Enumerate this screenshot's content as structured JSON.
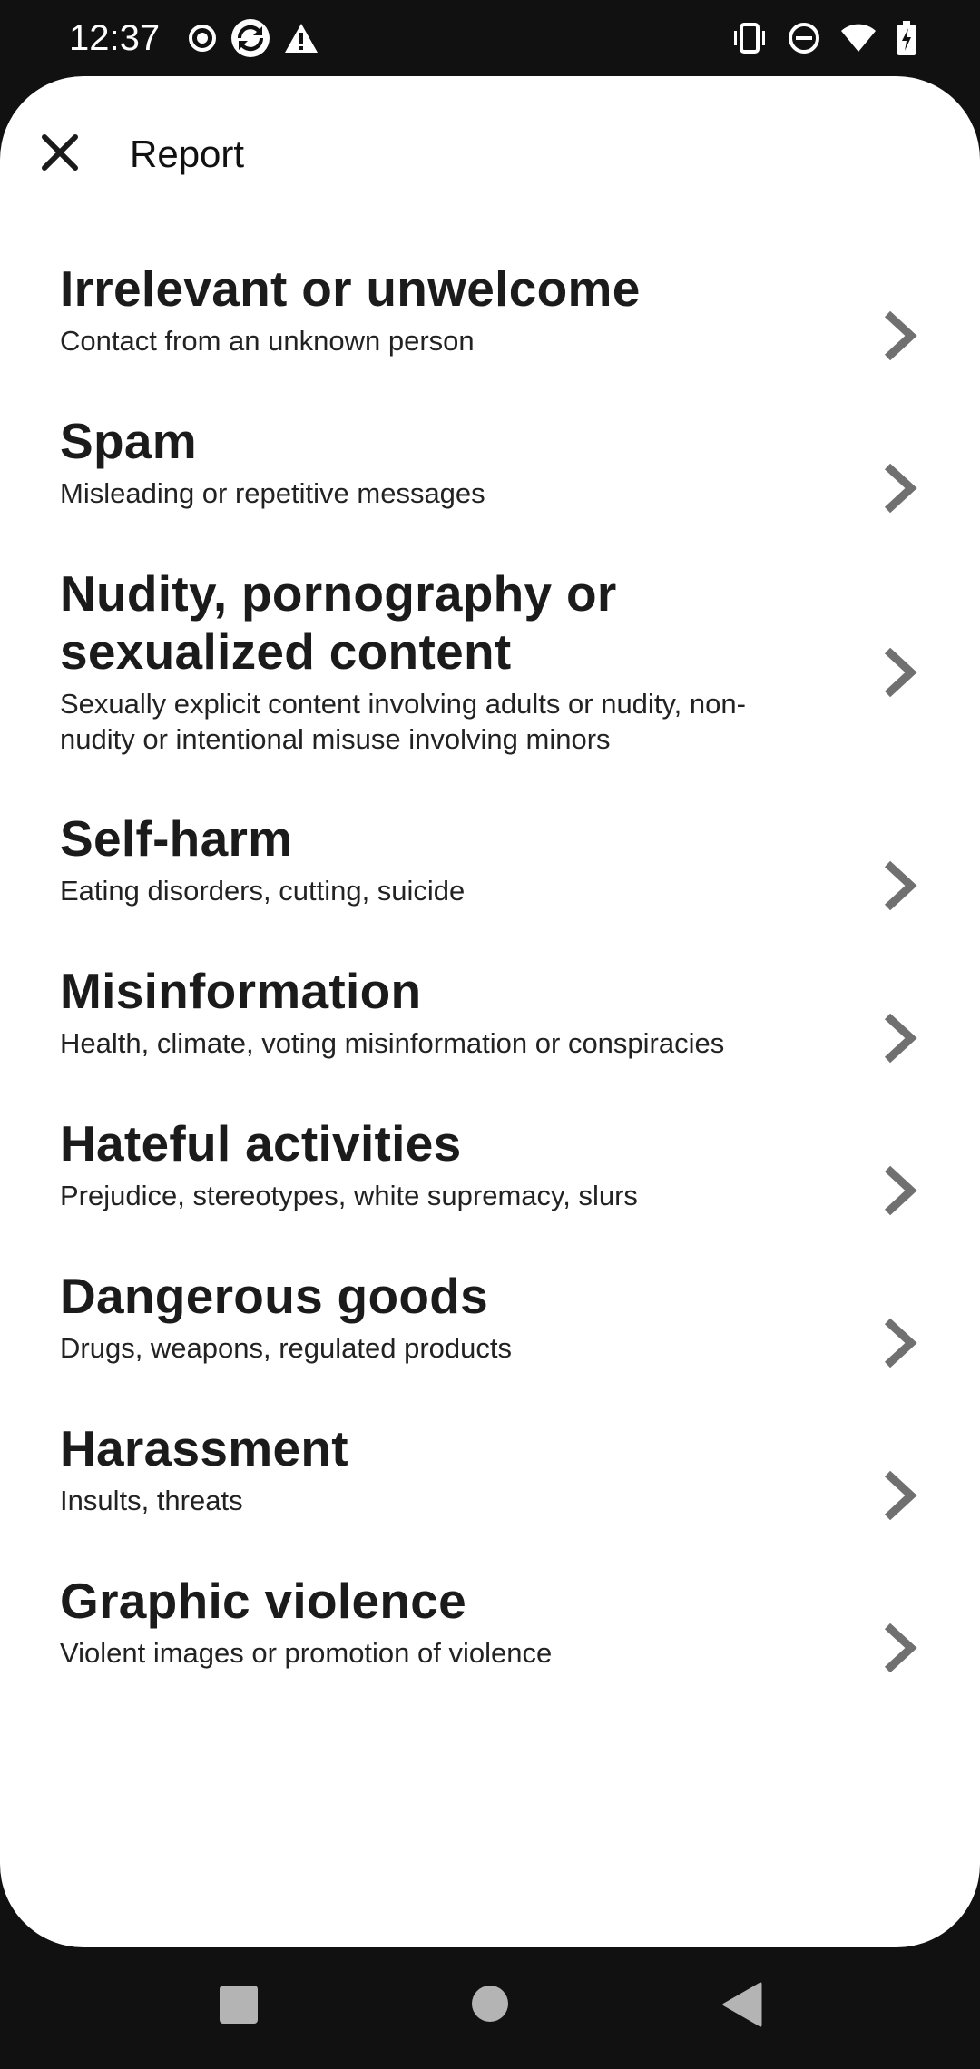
{
  "status_bar": {
    "time": "12:37",
    "left_icons": [
      "record-icon",
      "sync-icon",
      "warning-icon"
    ],
    "right_icons": [
      "vibrate-icon",
      "do-not-disturb-icon",
      "wifi-icon",
      "battery-charging-icon"
    ]
  },
  "sheet": {
    "title": "Report",
    "items": [
      {
        "title": "Irrelevant or unwelcome",
        "subtitle": "Contact from an unknown person"
      },
      {
        "title": "Spam",
        "subtitle": "Misleading or repetitive messages"
      },
      {
        "title": "Nudity, pornography or sexualized content",
        "subtitle": "Sexually explicit content involving adults or nudity, non-nudity or intentional misuse involving minors"
      },
      {
        "title": "Self-harm",
        "subtitle": "Eating disorders, cutting, suicide"
      },
      {
        "title": "Misinformation",
        "subtitle": "Health, climate, voting misinformation or conspiracies"
      },
      {
        "title": "Hateful activities",
        "subtitle": "Prejudice, stereotypes, white supremacy, slurs"
      },
      {
        "title": "Dangerous goods",
        "subtitle": "Drugs, weapons, regulated products"
      },
      {
        "title": "Harassment",
        "subtitle": "Insults, threats"
      },
      {
        "title": "Graphic violence",
        "subtitle": "Violent images or promotion of violence"
      }
    ]
  },
  "nav_bar": {
    "buttons": [
      "recents-button",
      "home-button",
      "back-button"
    ]
  },
  "colors": {
    "status_bar_bg": "#111111",
    "sheet_bg": "#ffffff",
    "text_primary": "#1b1b1b",
    "chevron": "#707070",
    "nav_icon": "#b4b4b4"
  }
}
